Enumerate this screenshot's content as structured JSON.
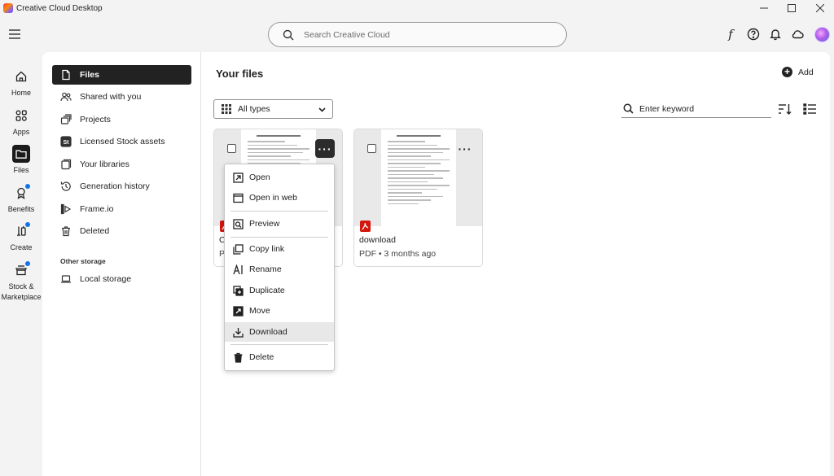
{
  "window": {
    "title": "Creative Cloud Desktop"
  },
  "search": {
    "placeholder": "Search Creative Cloud"
  },
  "rail": [
    {
      "label": "Home",
      "icon": "home-icon"
    },
    {
      "label": "Apps",
      "icon": "apps-icon"
    },
    {
      "label": "Files",
      "icon": "folder-icon",
      "active": true
    },
    {
      "label": "Benefits",
      "icon": "benefits-icon",
      "badge": true
    },
    {
      "label": "Create",
      "icon": "create-icon",
      "badge": true
    },
    {
      "label": "Stock &",
      "label2": "Marketplace",
      "icon": "stock-icon",
      "badge": true
    }
  ],
  "sidenav": {
    "items": [
      {
        "label": "Files",
        "icon": "files-icon",
        "active": true
      },
      {
        "label": "Shared with you",
        "icon": "shared-icon"
      },
      {
        "label": "Projects",
        "icon": "projects-icon"
      },
      {
        "label": "Licensed Stock assets",
        "icon": "stock-assets-icon"
      },
      {
        "label": "Your libraries",
        "icon": "libraries-icon"
      },
      {
        "label": "Generation history",
        "icon": "history-icon"
      },
      {
        "label": "Frame.io",
        "icon": "frameio-icon"
      },
      {
        "label": "Deleted",
        "icon": "trash-icon"
      }
    ],
    "other_storage_label": "Other storage",
    "local_storage_label": "Local storage"
  },
  "content": {
    "title": "Your files",
    "add_label": "Add",
    "type_filter": "All types",
    "keyword_placeholder": "Enter keyword"
  },
  "files": [
    {
      "name": "C",
      "meta": "P",
      "menu_open": true
    },
    {
      "name": "download",
      "meta": "PDF • 3 months ago"
    }
  ],
  "context_menu": [
    {
      "label": "Open",
      "icon": "open-icon"
    },
    {
      "label": "Open in web",
      "icon": "browser-icon"
    },
    {
      "label": "Preview",
      "icon": "preview-icon"
    },
    {
      "label": "Copy link",
      "icon": "copy-link-icon"
    },
    {
      "label": "Rename",
      "icon": "rename-icon"
    },
    {
      "label": "Duplicate",
      "icon": "duplicate-icon"
    },
    {
      "label": "Move",
      "icon": "move-icon"
    },
    {
      "label": "Download",
      "icon": "download-icon",
      "hover": true
    },
    {
      "label": "Delete",
      "icon": "delete-icon"
    }
  ],
  "colors": {
    "accent": "#1473e6",
    "pdf": "#d3170e",
    "active_bg": "#222222"
  }
}
